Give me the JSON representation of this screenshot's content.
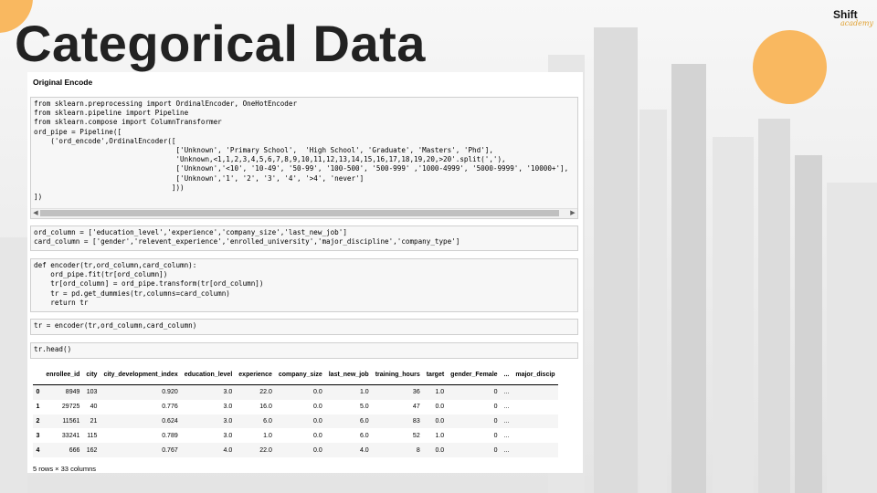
{
  "slide": {
    "title": "Categorical Data",
    "logo": {
      "main": "Shift",
      "sub": "academy"
    },
    "accent_color": "#f9b860"
  },
  "notebook": {
    "heading": "Original Encode",
    "cells": [
      "from sklearn.preprocessing import OrdinalEncoder, OneHotEncoder\nfrom sklearn.pipeline import Pipeline\nfrom sklearn.compose import ColumnTransformer\nord_pipe = Pipeline([\n    ('ord_encode',OrdinalEncoder([\n                                  ['Unknown', 'Primary School',  'High School', 'Graduate', 'Masters', 'Phd'],\n                                  'Unknown,<1,1,2,3,4,5,6,7,8,9,10,11,12,13,14,15,16,17,18,19,20,>20'.split(','),\n                                  ['Unknown','<10', '10-49', '50-99', '100-500', '500-999' ,'1000-4999', '5000-9999', '10000+'],\n                                  ['Unknown','1', '2', '3', '4', '>4', 'never']\n                                 ]))\n])",
      "ord_column = ['education_level','experience','company_size','last_new_job']\ncard_column = ['gender','relevent_experience','enrolled_university','major_discipline','company_type']",
      "def encoder(tr,ord_column,card_column):\n    ord_pipe.fit(tr[ord_column])\n    tr[ord_column] = ord_pipe.transform(tr[ord_column])\n    tr = pd.get_dummies(tr,columns=card_column)\n    return tr",
      "tr = encoder(tr,ord_column,card_column)",
      "tr.head()"
    ],
    "scroll_left": "◀",
    "scroll_right": "▶",
    "table": {
      "columns": [
        "",
        "enrollee_id",
        "city",
        "city_development_index",
        "education_level",
        "experience",
        "company_size",
        "last_new_job",
        "training_hours",
        "target",
        "gender_Female",
        "...",
        "major_discip"
      ],
      "rows": [
        [
          "0",
          "8949",
          "103",
          "0.920",
          "3.0",
          "22.0",
          "0.0",
          "1.0",
          "36",
          "1.0",
          "0",
          "..."
        ],
        [
          "1",
          "29725",
          "40",
          "0.776",
          "3.0",
          "16.0",
          "0.0",
          "5.0",
          "47",
          "0.0",
          "0",
          "..."
        ],
        [
          "2",
          "11561",
          "21",
          "0.624",
          "3.0",
          "6.0",
          "0.0",
          "6.0",
          "83",
          "0.0",
          "0",
          "..."
        ],
        [
          "3",
          "33241",
          "115",
          "0.789",
          "3.0",
          "1.0",
          "0.0",
          "6.0",
          "52",
          "1.0",
          "0",
          "..."
        ],
        [
          "4",
          "666",
          "162",
          "0.767",
          "4.0",
          "22.0",
          "0.0",
          "4.0",
          "8",
          "0.0",
          "0",
          "..."
        ]
      ]
    },
    "footer": "5 rows × 33 columns"
  }
}
